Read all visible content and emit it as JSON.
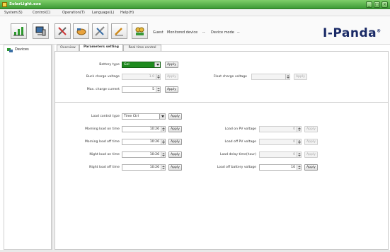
{
  "window": {
    "title": "SolarLight.exe"
  },
  "menu": [
    "System(S)",
    "Control(C)",
    "Operation(T)",
    "Language(L)",
    "Help(H)"
  ],
  "toolbar": {
    "status": {
      "guest": "Guest",
      "monitored_label": "Monitored device",
      "monitored_value": "--",
      "mode_label": "Device mode",
      "mode_value": "--"
    },
    "logo": "I-Panda",
    "logo_mark": "®"
  },
  "sidebar": {
    "root": "Devices"
  },
  "tabs": [
    "Overview",
    "Parameters setting",
    "Real time control"
  ],
  "apply_label": "Apply",
  "battery": {
    "type_label": "Battery type",
    "type_value": "Gel",
    "buck_label": "Buck charge voltage",
    "buck_value": "1.0",
    "max_current_label": "Max. charge current",
    "max_current_value": "5",
    "float_label": "Float charge voltage",
    "float_value": ""
  },
  "load": {
    "control_type_label": "Load control type",
    "control_type_value": "Time Ctrl",
    "morning_on_label": "Morning load on time",
    "morning_on_value": "10:26",
    "morning_off_label": "Morning load off time",
    "morning_off_value": "10:26",
    "night_on_label": "Night load on time",
    "night_on_value": "10:26",
    "night_off_label": "Night load off time",
    "night_off_value": "10:26",
    "pv_on_label": "Load on PV voltage",
    "pv_on_value": "0",
    "pv_off_label": "Load off PV voltage",
    "pv_off_value": "0",
    "delay_label": "Load delay time(hour)",
    "delay_value": "0",
    "batt_off_label": "Load off battery voltage",
    "batt_off_value": "10"
  }
}
